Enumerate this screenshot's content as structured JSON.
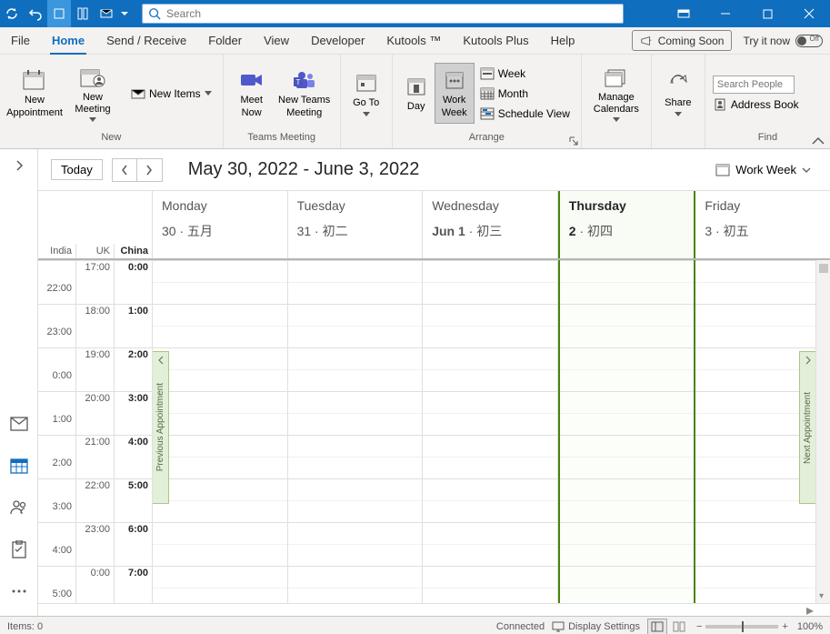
{
  "titlebar": {
    "search_placeholder": "Search"
  },
  "menu": {
    "file": "File",
    "home": "Home",
    "send_receive": "Send / Receive",
    "folder": "Folder",
    "view": "View",
    "developer": "Developer",
    "kutools": "Kutools ™",
    "kutools_plus": "Kutools Plus",
    "help": "Help",
    "coming_soon": "Coming Soon",
    "try_it_now": "Try it now",
    "toggle_off": "Off"
  },
  "ribbon": {
    "new": {
      "label": "New",
      "new_appointment": "New Appointment",
      "new_meeting": "New Meeting",
      "new_items": "New Items"
    },
    "teams": {
      "label": "Teams Meeting",
      "meet_now": "Meet Now",
      "new_teams": "New Teams Meeting"
    },
    "goto": {
      "label": "Go To"
    },
    "arrange": {
      "label": "Arrange",
      "day": "Day",
      "work_week": "Work Week",
      "week": "Week",
      "month": "Month",
      "schedule_view": "Schedule View"
    },
    "manage": {
      "label": "Manage Calendars"
    },
    "share": {
      "label": "Share"
    },
    "find": {
      "label": "Find",
      "search_people_ph": "Search People",
      "address_book": "Address Book"
    }
  },
  "cal": {
    "today": "Today",
    "range": "May 30, 2022 - June 3, 2022",
    "view_name": "Work Week",
    "tz": {
      "c1": "India",
      "c2": "UK",
      "c3": "China"
    },
    "days": [
      {
        "dow": "Monday",
        "num": "30",
        "sec": "五月"
      },
      {
        "dow": "Tuesday",
        "num": "31",
        "sec": "初二"
      },
      {
        "dow": "Wednesday",
        "num": "Jun 1",
        "sec": "初三"
      },
      {
        "dow": "Thursday",
        "num": "2",
        "sec": "初四"
      },
      {
        "dow": "Friday",
        "num": "3",
        "sec": "初五"
      }
    ],
    "prev_apt": "Previous Appointment",
    "next_apt": "Next Appointment",
    "time_rows": [
      {
        "india": "",
        "uk": "17:00",
        "china": "0:00"
      },
      {
        "india": "22:00",
        "uk": "",
        "china": ""
      },
      {
        "india": "",
        "uk": "18:00",
        "china": "1:00"
      },
      {
        "india": "23:00",
        "uk": "",
        "china": ""
      },
      {
        "india": "",
        "uk": "19:00",
        "china": "2:00"
      },
      {
        "india": "0:00",
        "uk": "",
        "china": ""
      },
      {
        "india": "",
        "uk": "20:00",
        "china": "3:00"
      },
      {
        "india": "1:00",
        "uk": "",
        "china": ""
      },
      {
        "india": "",
        "uk": "21:00",
        "china": "4:00"
      },
      {
        "india": "2:00",
        "uk": "",
        "china": ""
      },
      {
        "india": "",
        "uk": "22:00",
        "china": "5:00"
      },
      {
        "india": "3:00",
        "uk": "",
        "china": ""
      },
      {
        "india": "",
        "uk": "23:00",
        "china": "6:00"
      },
      {
        "india": "4:00",
        "uk": "",
        "china": ""
      },
      {
        "india": "",
        "uk": "0:00",
        "china": "7:00"
      },
      {
        "india": "5:00",
        "uk": "",
        "china": ""
      }
    ]
  },
  "status": {
    "items": "Items: 0",
    "connected": "Connected",
    "display_settings": "Display Settings",
    "zoom": "100%"
  }
}
